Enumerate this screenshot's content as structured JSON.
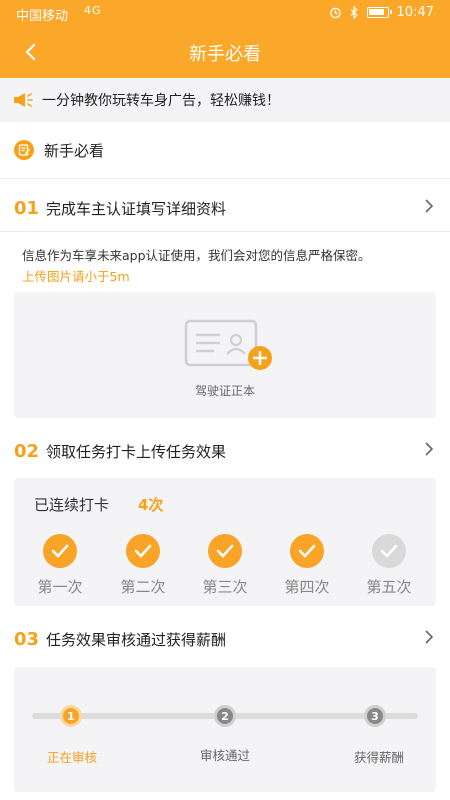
{
  "status_bar": {
    "carrier": "中国移动",
    "network": "4G",
    "time": "10:47"
  },
  "nav": {
    "title": "新手必看"
  },
  "notice": {
    "text": "一分钟教你玩转车身广告，轻松赚钱！"
  },
  "guide": {
    "title": "新手必看"
  },
  "steps": [
    {
      "num": "01",
      "title": "完成车主认证填写详细资料"
    },
    {
      "num": "02",
      "title": "领取任务打卡上传任务效果"
    },
    {
      "num": "03",
      "title": "任务效果审核通过获得薪酬"
    }
  ],
  "step1": {
    "info": "信息作为车享未来app认证使用，我们会对您的信息严格保密。",
    "warn": "上传图片请小于5m",
    "upload_caption": "驾驶证正本"
  },
  "step2": {
    "checkin_label": "已连续打卡",
    "checkin_count": "4次",
    "days": [
      {
        "label": "第一次",
        "done": true
      },
      {
        "label": "第二次",
        "done": true
      },
      {
        "label": "第三次",
        "done": true
      },
      {
        "label": "第四次",
        "done": true
      },
      {
        "label": "第五次",
        "done": false
      }
    ]
  },
  "step3": {
    "stages": [
      {
        "num": "1",
        "label": "正在审核",
        "active": true
      },
      {
        "num": "2",
        "label": "审核通过",
        "active": false
      },
      {
        "num": "3",
        "label": "获得薪酬",
        "active": false
      }
    ]
  },
  "colors": {
    "brand": "#fba82a",
    "accent": "#f6a11a",
    "card_bg": "#f4f4f6"
  }
}
